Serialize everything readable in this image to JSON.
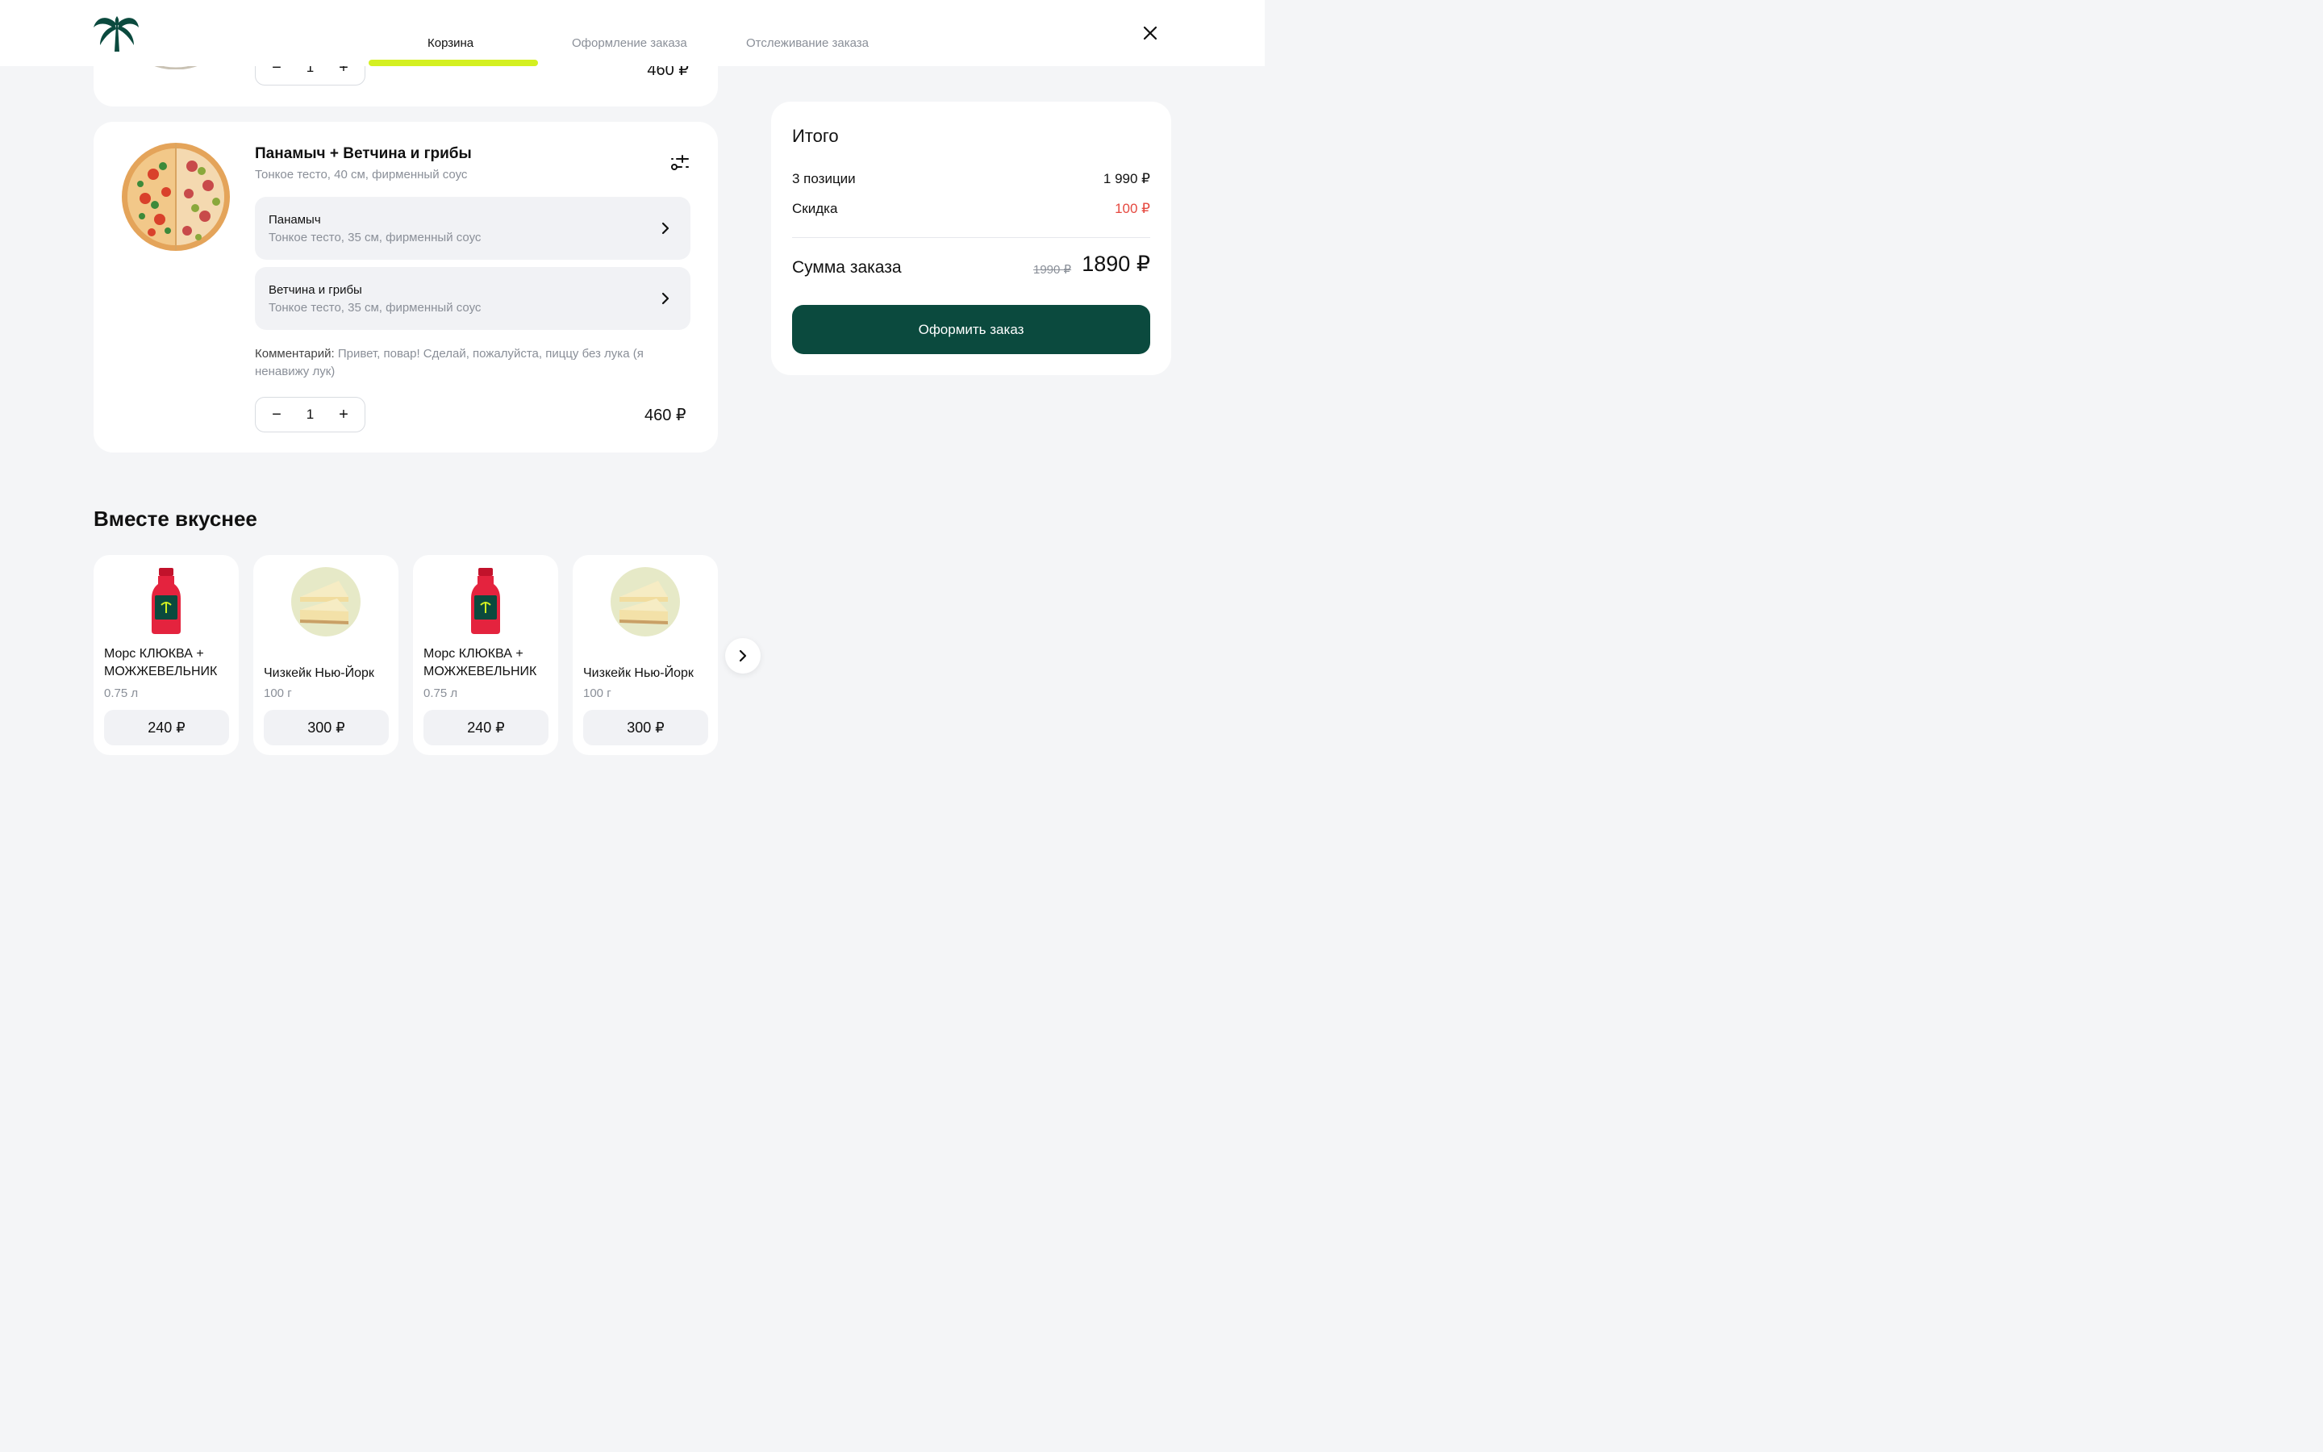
{
  "tabs": [
    {
      "label": "Корзина"
    },
    {
      "label": "Оформление заказа"
    },
    {
      "label": "Отслеживание заказа"
    }
  ],
  "colors": {
    "brand": "#0b4a3e",
    "accent": "#d4f021",
    "discount": "#e5483f"
  },
  "cart": {
    "prev_item": {
      "qty": "1",
      "price": "460 ₽"
    },
    "item": {
      "title": "Панамыч + Ветчина и грибы",
      "subtitle": "Тонкое тесто, 40 см, фирменный соус",
      "halves": [
        {
          "name": "Панамыч",
          "desc": "Тонкое тесто, 35 см, фирменный соус"
        },
        {
          "name": "Ветчина и грибы",
          "desc": "Тонкое тесто, 35 см, фирменный соус"
        }
      ],
      "comment_label": "Комментарий:",
      "comment_text": "Привет, повар! Сделай, пожалуйста, пиццу без лука (я ненавижу лук)",
      "qty": "1",
      "price": "460 ₽",
      "minus": "−",
      "plus": "+"
    }
  },
  "recommend": {
    "title": "Вместе вкуснее",
    "products": [
      {
        "name": "Морс КЛЮКВА + МОЖЖЕВЕЛЬНИК",
        "weight": "0.75 л",
        "price": "240 ₽",
        "kind": "bottle-icon"
      },
      {
        "name": "Чизкейк Нью-Йорк",
        "weight": "100 г",
        "price": "300 ₽",
        "kind": "cheesecake-icon"
      },
      {
        "name": "Морс КЛЮКВА + МОЖЖЕВЕЛЬНИК",
        "weight": "0.75 л",
        "price": "240 ₽",
        "kind": "bottle-icon"
      },
      {
        "name": "Чизкейк Нью-Йорк",
        "weight": "100 г",
        "price": "300 ₽",
        "kind": "cheesecake-icon"
      }
    ]
  },
  "summary": {
    "title": "Итого",
    "items_label": "3 позиции",
    "items_value": "1 990 ₽",
    "discount_label": "Скидка",
    "discount_value": "100 ₽",
    "total_label": "Сумма заказа",
    "old_total": "1990 ₽",
    "total": "1890 ₽",
    "cta": "Оформить заказ"
  }
}
